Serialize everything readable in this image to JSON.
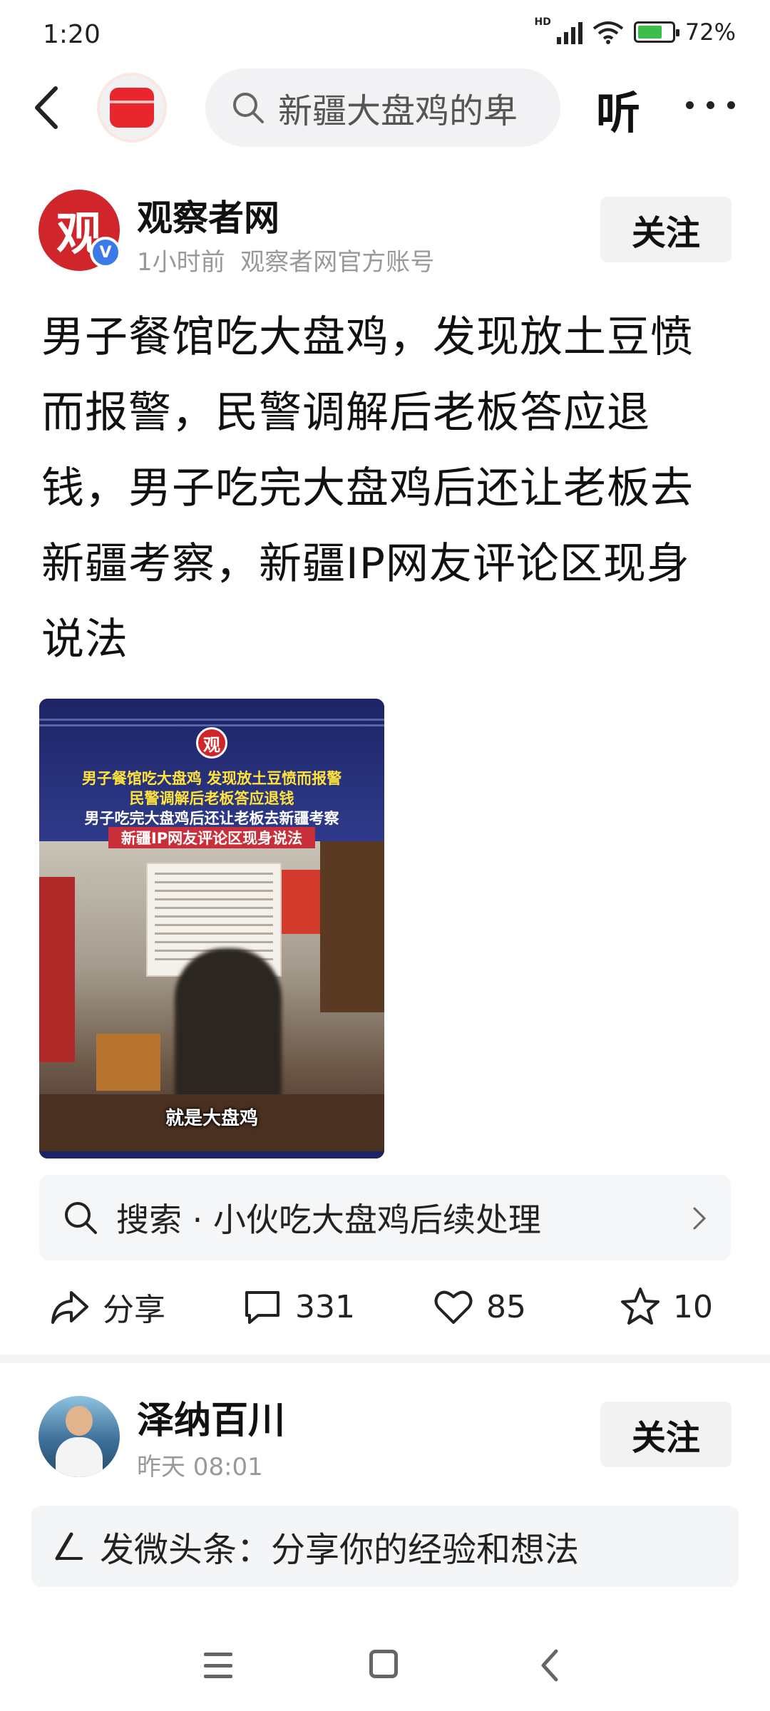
{
  "status_bar": {
    "time": "1:20",
    "network": "HD",
    "battery_percent": "72%",
    "battery_level": 0.72
  },
  "top_bar": {
    "search_text": "新疆大盘鸡的卑",
    "listen_label": "听"
  },
  "post": {
    "author": {
      "name": "观察者网",
      "avatar_glyph": "观",
      "time": "1小时前",
      "description": "观察者网官方账号",
      "follow_label": "关注"
    },
    "headline": "男子餐馆吃大盘鸡，发现放土豆愤而报警，民警调解后老板答应退钱，男子吃完大盘鸡后还让老板去新疆考察，新疆IP网友评论区现身说法",
    "image": {
      "logo_glyph": "观",
      "line1": "男子餐馆吃大盘鸡 发现放土豆愤而报警",
      "line2": "民警调解后老板答应退钱",
      "line3": "男子吃完大盘鸡后还让老板去新疆考察",
      "line4": "新疆IP网友评论区现身说法",
      "subtitle": "就是大盘鸡"
    },
    "suggestion": {
      "text": "搜索 · 小伙吃大盘鸡后续处理"
    },
    "actions": {
      "share_label": "分享",
      "comment_count": "331",
      "like_count": "85",
      "favorite_count": "10"
    }
  },
  "next_post": {
    "author": {
      "name": "泽纳百川",
      "time": "昨天  08:01",
      "follow_label": "关注"
    }
  },
  "compose": {
    "placeholder": "发微头条：分享你的经验和想法"
  },
  "colors": {
    "accent_red": "#e8262d",
    "verified_blue": "#3b7be8",
    "battery_green": "#3cbf4a"
  },
  "icons": [
    "back-icon",
    "search-icon",
    "more-icon",
    "verified-icon",
    "chevron-right-icon",
    "share-icon",
    "comment-icon",
    "like-icon",
    "favorite-icon",
    "pen-icon",
    "nav-menu-icon",
    "nav-home-icon",
    "nav-back-icon"
  ]
}
